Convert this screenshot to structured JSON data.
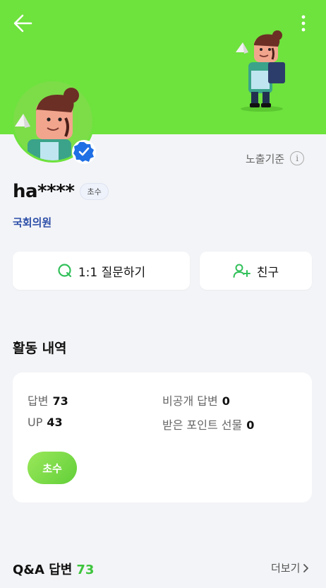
{
  "header": {
    "back_icon": "arrow-left-icon",
    "more_icon": "more-vertical-icon",
    "bg_color": "#6ee23d"
  },
  "profile": {
    "username": "ha****",
    "grade_badge": "초수",
    "title": "국회의원",
    "exposure_label": "노출기준",
    "info_icon_glyph": "i"
  },
  "actions": {
    "ask_label": "1:1 질문하기",
    "friend_label": "친구"
  },
  "activity": {
    "section_title": "활동 내역",
    "answers_label": "답변",
    "answers_value": "73",
    "private_label": "비공개 답변",
    "private_value": "0",
    "up_label": "UP",
    "up_value": "43",
    "points_label": "받은 포인트 선물",
    "points_value": "0",
    "grade_label": "초수"
  },
  "qa": {
    "title": "Q&A 답변",
    "count": "73",
    "more_label": "더보기"
  },
  "colors": {
    "accent_green": "#6ee23d",
    "link_blue": "#2c4ea8",
    "count_green": "#3cc43c",
    "verified_blue": "#1f6fe5"
  }
}
